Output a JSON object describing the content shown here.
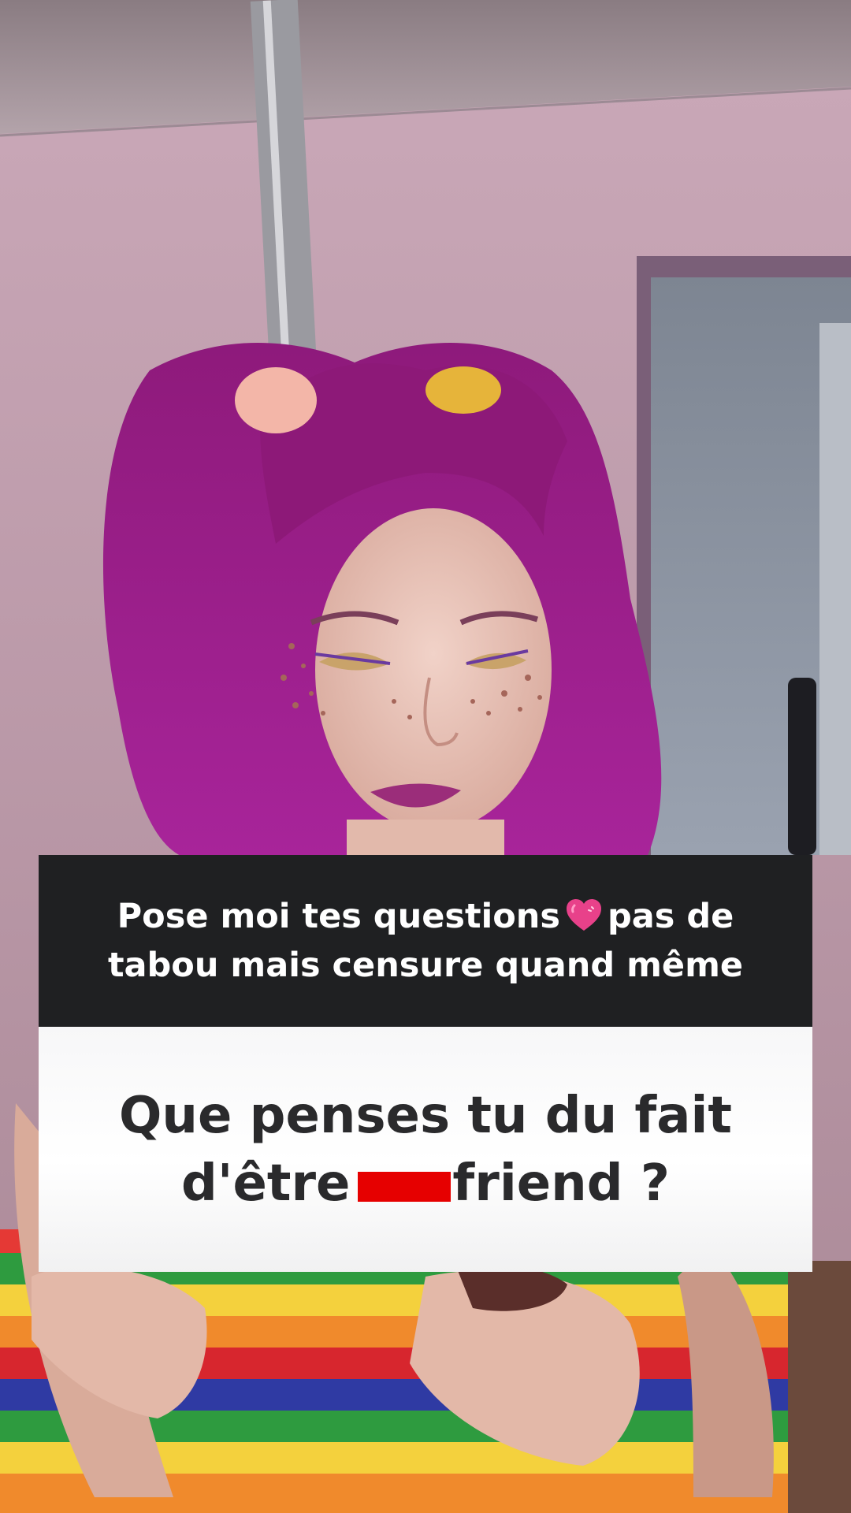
{
  "question_card": {
    "header_line1_a": "Pose moi tes questions",
    "header_icon": "pink-heart-emoji",
    "header_line1_b": "pas de",
    "header_line2": "tabou mais censure quand même",
    "question_line1": "Que penses tu du fait",
    "question_line2_a": "d'être",
    "question_line2_b": "friend ?",
    "redaction_color": "#e60000"
  },
  "background_photo": "person-with-magenta-pigtails-rainbow-striped-shirt"
}
